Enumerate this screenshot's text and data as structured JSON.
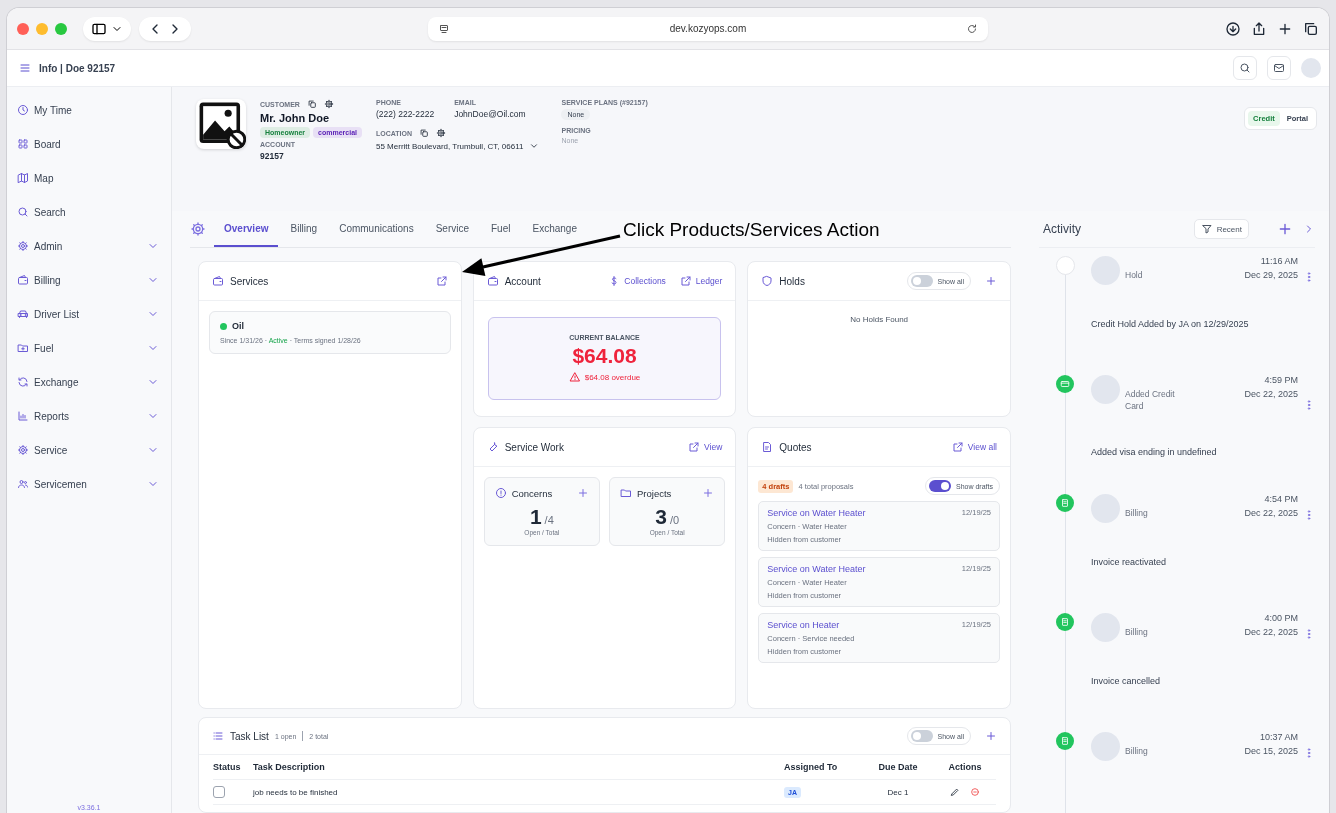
{
  "browser": {
    "url": "dev.kozyops.com"
  },
  "app_bar": {
    "title": "Info | Doe 92157"
  },
  "sidebar": {
    "items": [
      {
        "label": "My Time",
        "kind": "link"
      },
      {
        "label": "Board",
        "kind": "link"
      },
      {
        "label": "Map",
        "kind": "link"
      },
      {
        "label": "Search",
        "kind": "link"
      },
      {
        "label": "Admin",
        "kind": "group",
        "expanded": false
      },
      {
        "label": "Billing",
        "kind": "group",
        "expanded": false
      },
      {
        "label": "Driver List",
        "kind": "group",
        "expanded": false
      },
      {
        "label": "Fuel",
        "kind": "group",
        "expanded": false
      },
      {
        "label": "Exchange",
        "kind": "group",
        "expanded": false
      },
      {
        "label": "Reports",
        "kind": "group",
        "expanded": false
      },
      {
        "label": "Service",
        "kind": "group",
        "expanded": false
      },
      {
        "label": "Servicemen",
        "kind": "group",
        "expanded": false
      }
    ],
    "version": "v3.36.1"
  },
  "customer": {
    "label": "CUSTOMER",
    "name": "Mr. John Doe",
    "tags": [
      {
        "label": "Homeowner",
        "color": "#15803d"
      },
      {
        "label": "commercial",
        "color": "#5b21b6"
      }
    ],
    "account_label": "ACCOUNT",
    "account": "92157",
    "phone_label": "PHONE",
    "phone": "(222) 222-2222",
    "email_label": "EMAIL",
    "email": "JohnDoe@Oil.com",
    "location_label": "LOCATION",
    "address": "55 Merritt Boulevard, Trumbull, CT, 06611",
    "plans_label": "SERVICE PLANS (#92157)",
    "plan": "None",
    "pricing_label": "PRICING",
    "pricing": "None",
    "portal_buttons": [
      {
        "label": "Credit",
        "selected": true
      },
      {
        "label": "Portal",
        "selected": false
      }
    ]
  },
  "tabs": [
    {
      "label": "Overview",
      "selected": true
    },
    {
      "label": "Billing",
      "selected": false
    },
    {
      "label": "Communications",
      "selected": false
    },
    {
      "label": "Service",
      "selected": false
    },
    {
      "label": "Fuel",
      "selected": false
    },
    {
      "label": "Exchange",
      "selected": false
    }
  ],
  "annotation": {
    "text": "Click Products/Services Action"
  },
  "services": {
    "title": "Services",
    "items": [
      {
        "name": "Oil",
        "color": "#22c55e",
        "since": "Since 1/31/26 ·",
        "status": "Active",
        "terms": "· Terms signed 1/28/26"
      }
    ]
  },
  "account": {
    "title": "Account",
    "links": [
      "Collections",
      "Ledger"
    ],
    "balance_label": "CURRENT BALANCE",
    "balance": "$64.08",
    "overdue": "$64.08 overdue"
  },
  "holds": {
    "title": "Holds",
    "toggle": {
      "label": "Show all",
      "on": false
    },
    "empty": "No Holds Found"
  },
  "service_work": {
    "title": "Service Work",
    "link": "View",
    "counters": [
      {
        "title": "Concerns",
        "open": "1",
        "total": "/4",
        "caption": "Open / Total"
      },
      {
        "title": "Projects",
        "open": "3",
        "total": "/0",
        "caption": "Open / Total"
      }
    ]
  },
  "quotes": {
    "title": "Quotes",
    "link": "View all",
    "drafts": "4 drafts",
    "total": "4 total proposals",
    "toggle": {
      "label": "Show drafts",
      "on": true
    },
    "items": [
      {
        "title": "Service on Water Heater",
        "date": "12/19/25",
        "meta": "Concern · Water Heater",
        "visibility": "Hidden from customer"
      },
      {
        "title": "Service on Water Heater",
        "date": "12/19/25",
        "meta": "Concern · Water Heater",
        "visibility": "Hidden from customer"
      },
      {
        "title": "Service on Heater",
        "date": "12/19/25",
        "meta": "Concern · Service needed",
        "visibility": "Hidden from customer"
      }
    ]
  },
  "task_list": {
    "title": "Task List",
    "open": "1 open",
    "total": "2 total",
    "toggle": {
      "label": "Show all",
      "on": false
    },
    "columns": [
      "Status",
      "Task Description",
      "Assigned To",
      "Due Date",
      "Actions"
    ],
    "rows": [
      {
        "checked": false,
        "description": "job needs to be finished",
        "assignee": "JA",
        "due": "Dec 1"
      }
    ]
  },
  "activity": {
    "title": "Activity",
    "filter": "Recent",
    "items": [
      {
        "kind": "hold",
        "type": "Hold",
        "time": "11:16 AM",
        "date": "Dec 29, 2025",
        "message": "Credit Hold Added by JA on 12/29/2025"
      },
      {
        "kind": "card",
        "type": "Added Credit Card",
        "time": "4:59 PM",
        "date": "Dec 22, 2025",
        "message": "Added visa ending in undefined"
      },
      {
        "kind": "billing",
        "type": "Billing",
        "time": "4:54 PM",
        "date": "Dec 22, 2025",
        "message": "Invoice reactivated"
      },
      {
        "kind": "billing",
        "type": "Billing",
        "time": "4:00 PM",
        "date": "Dec 22, 2025",
        "message": "Invoice cancelled"
      },
      {
        "kind": "billing",
        "type": "Billing",
        "time": "10:37 AM",
        "date": "Dec 15, 2025"
      }
    ]
  }
}
